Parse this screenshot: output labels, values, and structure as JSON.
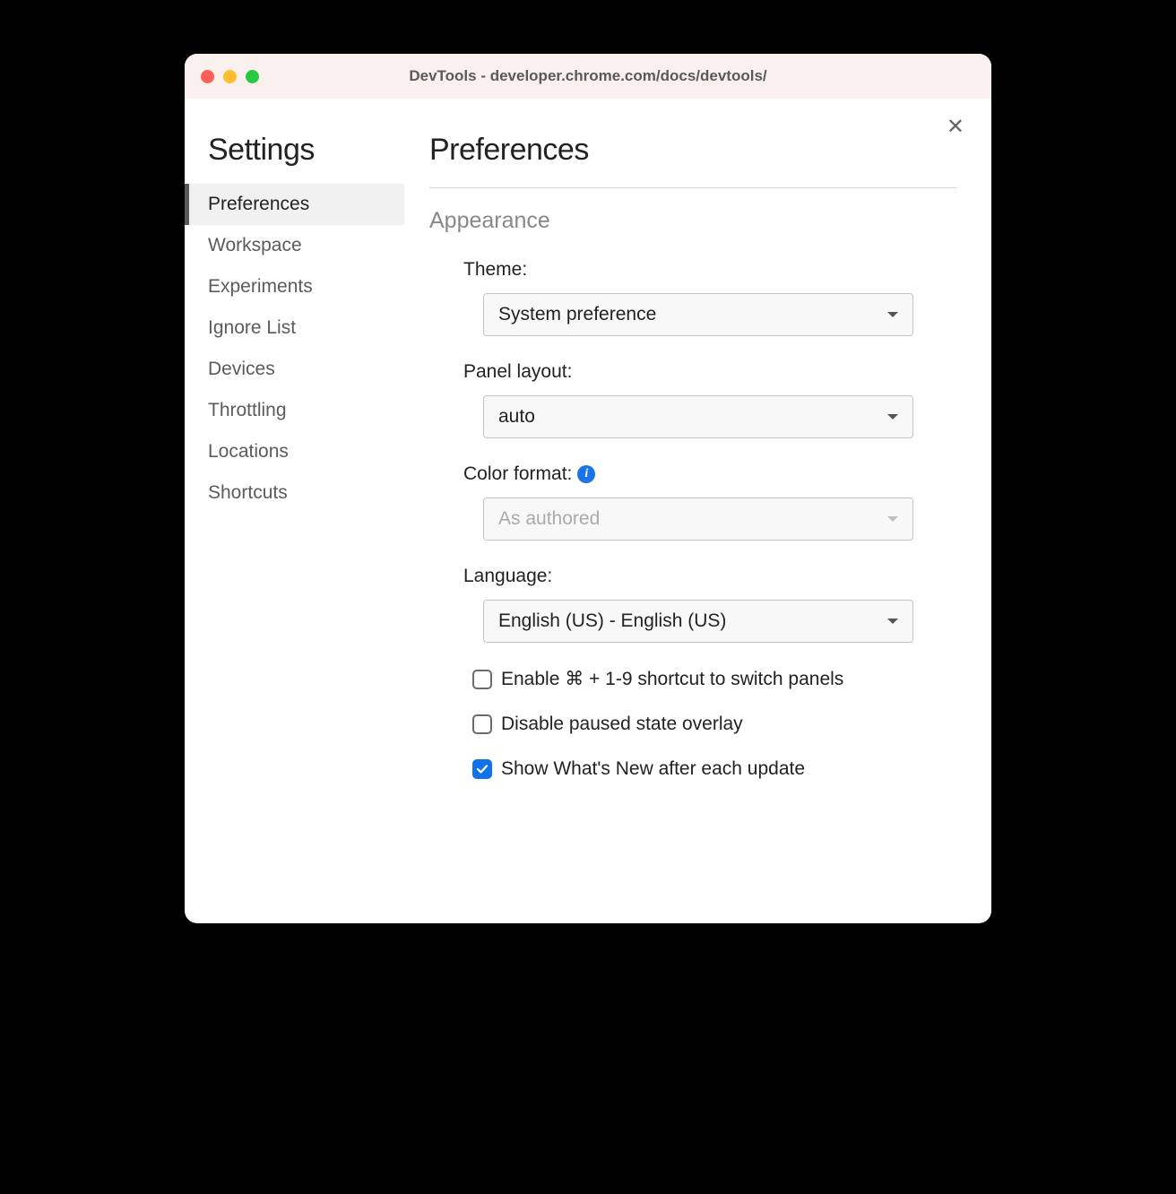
{
  "window": {
    "title": "DevTools - developer.chrome.com/docs/devtools/"
  },
  "sidebar": {
    "title": "Settings",
    "items": [
      {
        "label": "Preferences",
        "active": true
      },
      {
        "label": "Workspace",
        "active": false
      },
      {
        "label": "Experiments",
        "active": false
      },
      {
        "label": "Ignore List",
        "active": false
      },
      {
        "label": "Devices",
        "active": false
      },
      {
        "label": "Throttling",
        "active": false
      },
      {
        "label": "Locations",
        "active": false
      },
      {
        "label": "Shortcuts",
        "active": false
      }
    ]
  },
  "main": {
    "title": "Preferences",
    "section_header": "Appearance",
    "fields": {
      "theme": {
        "label": "Theme:",
        "value": "System preference"
      },
      "panel_layout": {
        "label": "Panel layout:",
        "value": "auto"
      },
      "color_format": {
        "label": "Color format:",
        "value": "As authored",
        "disabled": true,
        "has_info": true
      },
      "language": {
        "label": "Language:",
        "value": "English (US) - English (US)"
      }
    },
    "checkboxes": [
      {
        "label": "Enable ⌘ + 1-9 shortcut to switch panels",
        "checked": false
      },
      {
        "label": "Disable paused state overlay",
        "checked": false
      },
      {
        "label": "Show What's New after each update",
        "checked": true
      }
    ]
  }
}
